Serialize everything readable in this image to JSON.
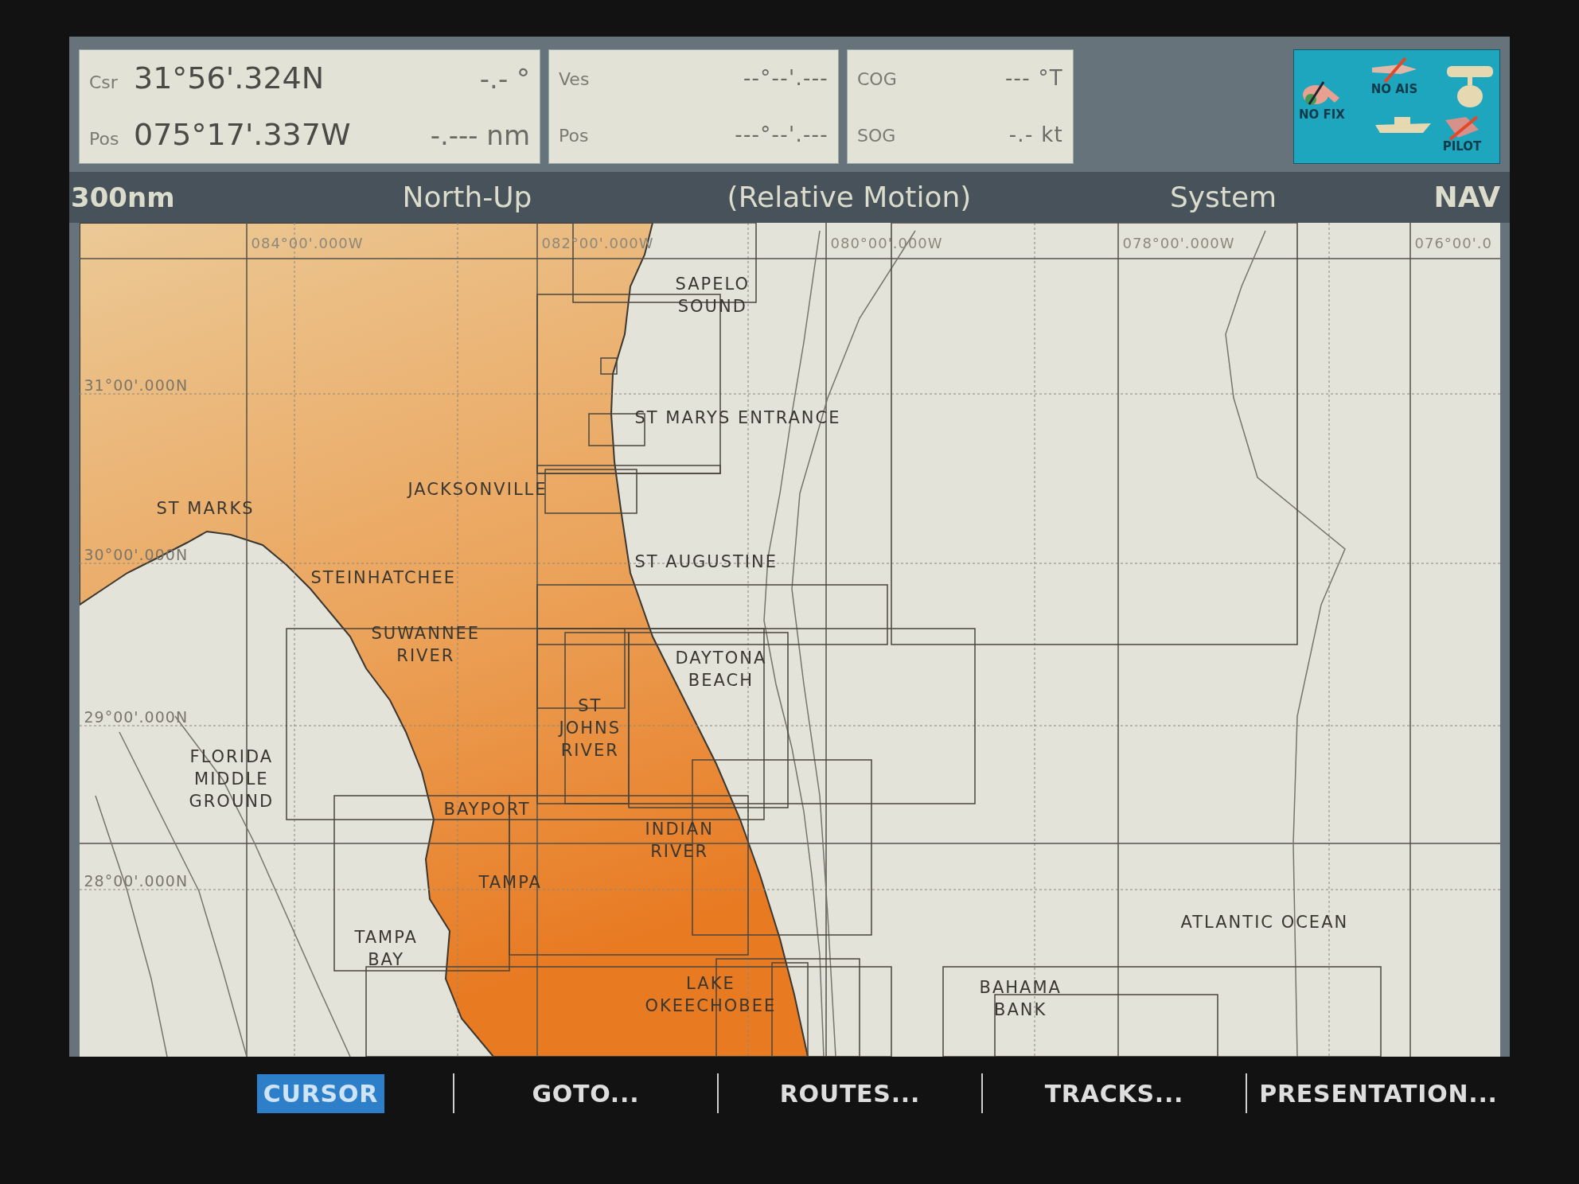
{
  "position_panel": {
    "rows": [
      {
        "label": "Csr",
        "value": "31°56'.324N",
        "reading": "-.- °"
      },
      {
        "label": "Pos",
        "value": "075°17'.337W",
        "reading": "-.--- nm"
      }
    ]
  },
  "vessel_panel": {
    "rows": [
      {
        "label": "Ves",
        "value": "--°--'.---"
      },
      {
        "label": "Pos",
        "value": "---°--'.---"
      }
    ]
  },
  "speed_panel": {
    "rows": [
      {
        "label": "COG",
        "value": "--- °T"
      },
      {
        "label": "SOG",
        "value": "-.- kt"
      }
    ]
  },
  "status_icons": [
    {
      "kind": "fix",
      "label": "NO FIX"
    },
    {
      "kind": "ais",
      "label": "NO AIS"
    },
    {
      "kind": "radar"
    },
    {
      "kind": "boat"
    },
    {
      "kind": "pilot",
      "label": "PILOT"
    }
  ],
  "header": {
    "range": "300nm",
    "orientation": "North-Up",
    "motion": "(Relative Motion)",
    "source": "System",
    "mode": "NAV"
  },
  "chart": {
    "longitude_labels": [
      "084°00'.000W",
      "082°00'.000W",
      "080°00'.000W",
      "078°00'.000W",
      "076°00'.0"
    ],
    "latitude_labels": [
      "31°00'.000N",
      "30°00'.000N",
      "29°00'.000N",
      "28°00'.000N"
    ],
    "places": [
      {
        "kind": "stacked",
        "text": "SAPELO SOUND"
      },
      {
        "kind": "single",
        "text": "ST MARYS ENTRANCE"
      },
      {
        "kind": "single",
        "text": "JACKSONVILLE"
      },
      {
        "kind": "single",
        "text": "ST MARKS"
      },
      {
        "kind": "single",
        "text": "ST AUGUSTINE"
      },
      {
        "kind": "single",
        "text": "STEINHATCHEE"
      },
      {
        "kind": "stacked",
        "text": "SUWANNEE RIVER"
      },
      {
        "kind": "stacked",
        "text": "DAYTONA BEACH"
      },
      {
        "kind": "stacked",
        "text": "ST JOHNS RIVER"
      },
      {
        "kind": "stacked",
        "text": "FLORIDA MIDDLE GROUND"
      },
      {
        "kind": "single",
        "text": "BAYPORT"
      },
      {
        "kind": "stacked",
        "text": "INDIAN RIVER"
      },
      {
        "kind": "single",
        "text": "TAMPA"
      },
      {
        "kind": "single",
        "text": "ATLANTIC OCEAN"
      },
      {
        "kind": "stacked",
        "text": "TAMPA BAY"
      },
      {
        "kind": "stacked",
        "text": "LAKE OKEECHOBEE"
      },
      {
        "kind": "stacked",
        "text": "BAHAMA BANK"
      }
    ]
  },
  "softkeys": [
    {
      "label": "CURSOR",
      "selected": true
    },
    {
      "label": "GOTO...",
      "selected": false
    },
    {
      "label": "ROUTES...",
      "selected": false
    },
    {
      "label": "TRACKS...",
      "selected": false
    },
    {
      "label": "PRESENTATION...",
      "selected": false
    }
  ]
}
